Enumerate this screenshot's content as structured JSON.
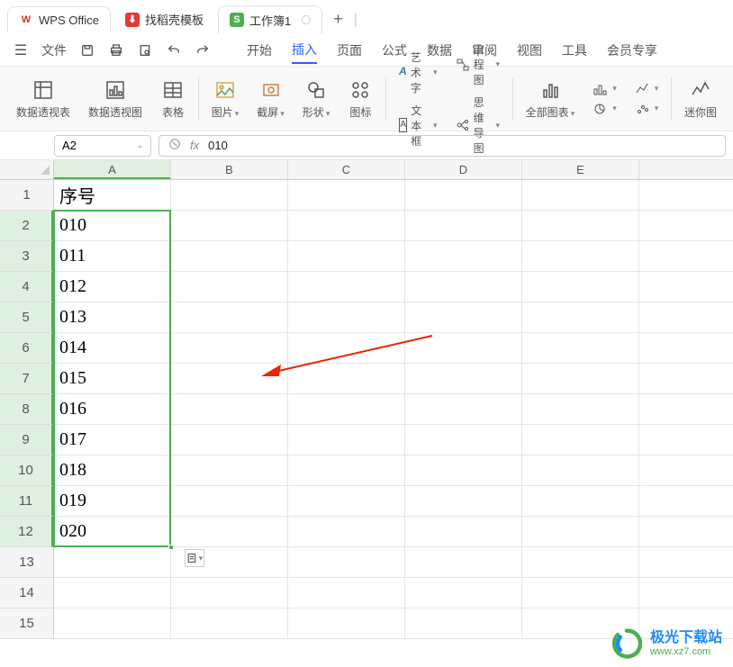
{
  "titlebar": {
    "tabs": [
      {
        "label": "WPS Office",
        "icon": "W"
      },
      {
        "label": "找稻壳模板",
        "icon": "⬇"
      },
      {
        "label": "工作簿1",
        "icon": "S"
      }
    ],
    "add": "+"
  },
  "menubar": {
    "hamburger_label": "文件",
    "tabs": [
      "开始",
      "插入",
      "页面",
      "公式",
      "数据",
      "审阅",
      "视图",
      "工具",
      "会员专享"
    ],
    "active_index": 1
  },
  "ribbon": {
    "pivot_table": "数据透视表",
    "pivot_chart": "数据透视图",
    "table": "表格",
    "picture": "图片",
    "screenshot": "截屏",
    "shape": "形状",
    "icon": "图标",
    "wordart": "艺术字",
    "textbox": "文本框",
    "flowchart": "流程图",
    "mindmap": "思维导图",
    "all_charts": "全部图表",
    "mini_chart": "迷你图"
  },
  "fbar": {
    "namebox": "A2",
    "fx": "fx",
    "value": "010"
  },
  "grid": {
    "columns": [
      "A",
      "B",
      "C",
      "D",
      "E"
    ],
    "selected_col": 0,
    "rows": [
      {
        "num": "1",
        "a": "序号",
        "sel": false
      },
      {
        "num": "2",
        "a": "010",
        "sel": true
      },
      {
        "num": "3",
        "a": "011",
        "sel": true
      },
      {
        "num": "4",
        "a": "012",
        "sel": true
      },
      {
        "num": "5",
        "a": "013",
        "sel": true
      },
      {
        "num": "6",
        "a": "014",
        "sel": true
      },
      {
        "num": "7",
        "a": "015",
        "sel": true
      },
      {
        "num": "8",
        "a": "016",
        "sel": true
      },
      {
        "num": "9",
        "a": "017",
        "sel": true
      },
      {
        "num": "10",
        "a": "018",
        "sel": true
      },
      {
        "num": "11",
        "a": "019",
        "sel": true
      },
      {
        "num": "12",
        "a": "020",
        "sel": true
      },
      {
        "num": "13",
        "a": "",
        "sel": false
      },
      {
        "num": "14",
        "a": "",
        "sel": false
      },
      {
        "num": "15",
        "a": "",
        "sel": false
      }
    ]
  },
  "watermark": {
    "title": "极光下载站",
    "url": "www.xz7.com"
  }
}
